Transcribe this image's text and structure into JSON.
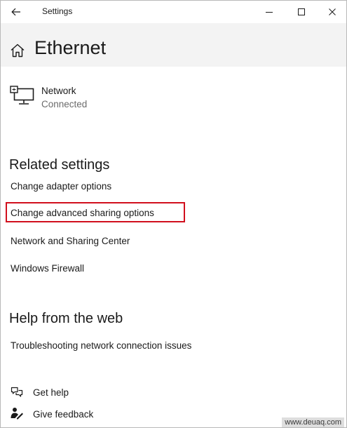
{
  "window": {
    "title": "Settings"
  },
  "page": {
    "title": "Ethernet"
  },
  "network": {
    "name": "Network",
    "status": "Connected",
    "icon": "network-computer-icon"
  },
  "related_settings": {
    "heading": "Related settings",
    "links": [
      "Change adapter options",
      "Change advanced sharing options",
      "Network and Sharing Center",
      "Windows Firewall"
    ],
    "highlighted_index": 1,
    "highlight_color": "#d10f1d"
  },
  "help": {
    "heading": "Help from the web",
    "links": [
      "Troubleshooting network connection issues"
    ]
  },
  "footer": {
    "get_help": "Get help",
    "give_feedback": "Give feedback"
  },
  "watermark": "www.deuaq.com",
  "colors": {
    "header_bg": "#f3f3f3",
    "text": "#1a1a1a",
    "secondary_text": "#6b6b6b"
  }
}
